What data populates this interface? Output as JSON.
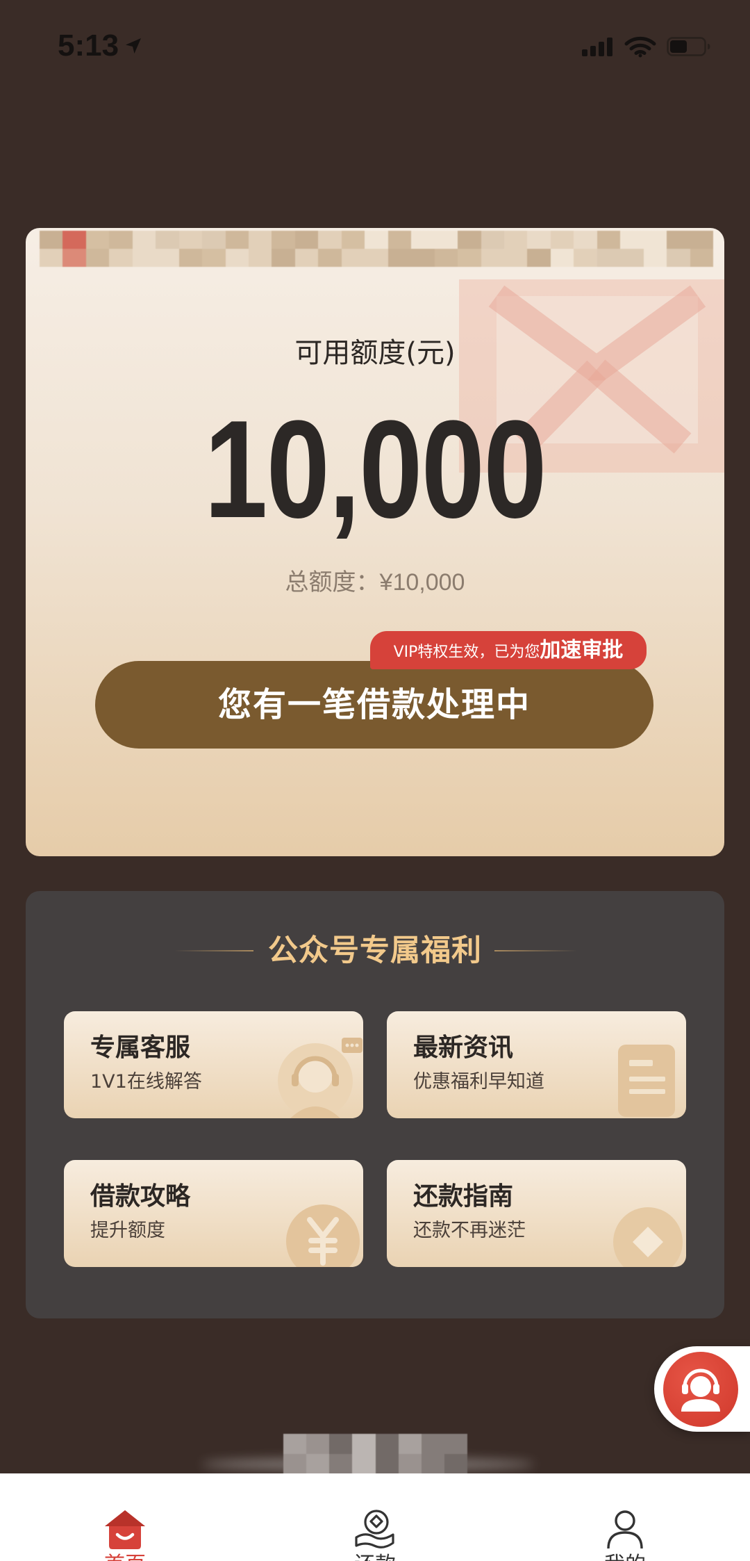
{
  "status_bar": {
    "time": "5:13",
    "battery_level": 0.5,
    "icons": [
      "location-arrow-icon",
      "cellular-signal-icon",
      "wifi-icon",
      "battery-icon"
    ]
  },
  "credit_card": {
    "available_label": "可用额度(元)",
    "available_amount": "10,000",
    "total_label": "总额度：",
    "total_value": "¥10,000",
    "badge": {
      "prefix": "VIP特权生效，已为您",
      "highlight": "加速审批"
    },
    "action_button": "您有一笔借款处理中"
  },
  "benefits": {
    "title": "公众号专属福利",
    "tiles": [
      {
        "title": "专属客服",
        "subtitle": "1V1在线解答",
        "icon": "customer-service-icon"
      },
      {
        "title": "最新资讯",
        "subtitle": "优惠福利早知道",
        "icon": "news-document-icon"
      },
      {
        "title": "借款攻略",
        "subtitle": "提升额度",
        "icon": "yuan-coin-icon"
      },
      {
        "title": "还款指南",
        "subtitle": "还款不再迷茫",
        "icon": "diamond-icon"
      }
    ]
  },
  "floating_service": {
    "icon": "customer-service-agent-icon"
  },
  "bottom_nav": {
    "items": [
      {
        "label": "首页",
        "icon": "home-icon",
        "active": true
      },
      {
        "label": "还款",
        "icon": "repay-icon",
        "active": false
      },
      {
        "label": "我的",
        "icon": "profile-icon",
        "active": false
      }
    ]
  },
  "colors": {
    "background": "#3a2c27",
    "card_top": "#f6eee5",
    "card_bottom": "#e6cca9",
    "accent_red": "#d6423a",
    "button_brown": "#7a5a2f",
    "panel": "#444040",
    "gold": "#f2c98b",
    "tile_top": "#f7ecde",
    "tile_bottom": "#ead3b3",
    "text_dark": "#2c2724",
    "muted_text": "#8b7c6e"
  }
}
